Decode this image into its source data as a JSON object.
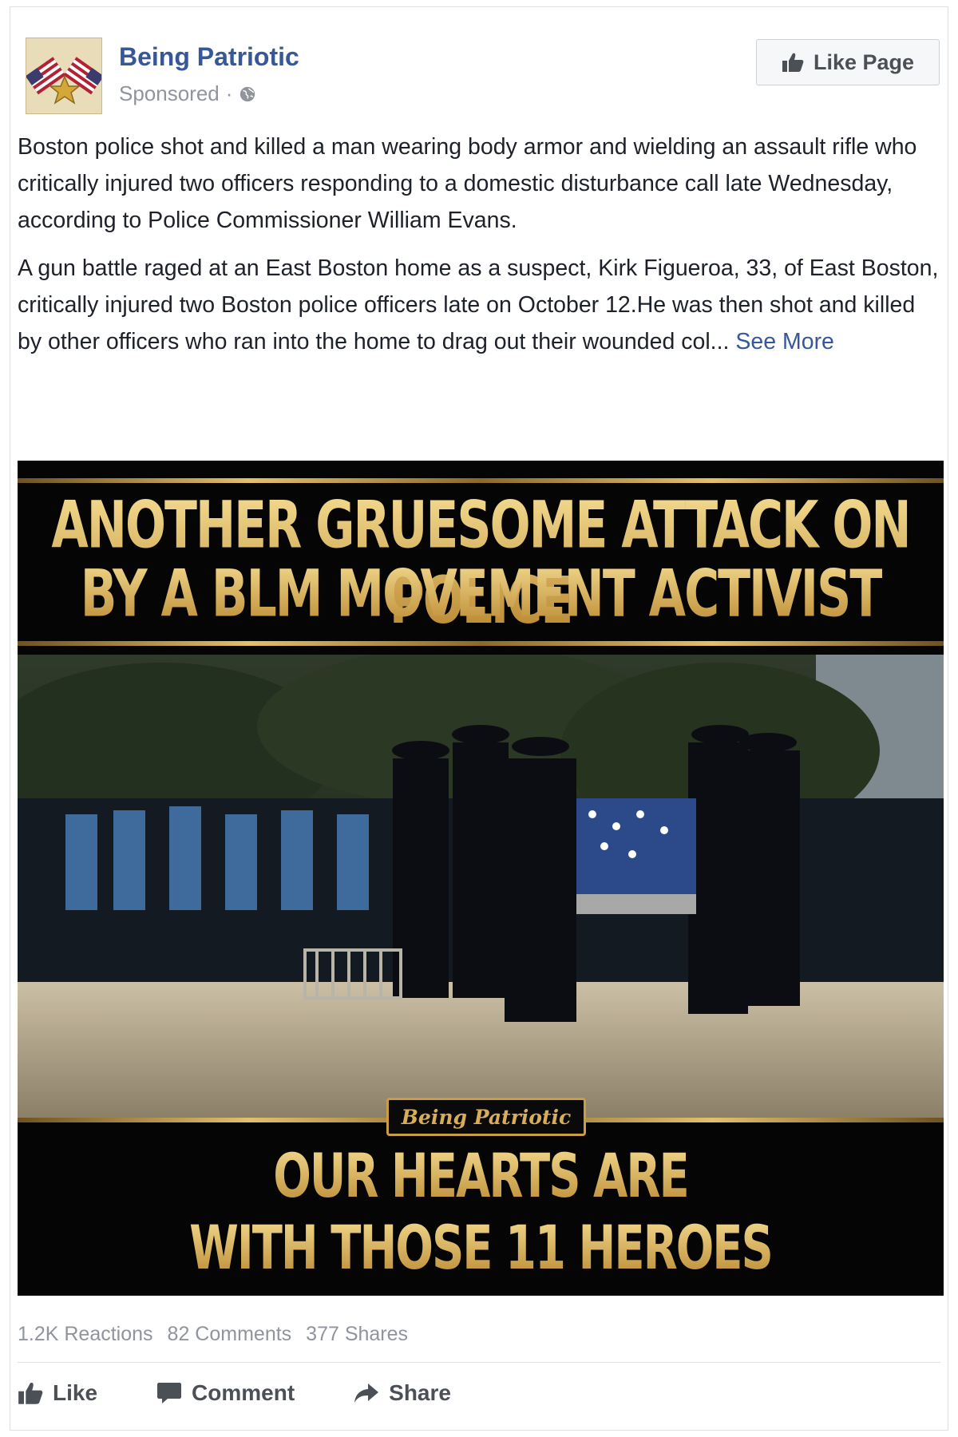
{
  "post": {
    "page_name": "Being Patriotic",
    "sponsored_label": "Sponsored",
    "meta_separator": "·",
    "like_page_label": "Like Page",
    "paragraphs": [
      "Boston police shot and killed a man wearing body armor and wielding an assault rifle who critically injured two officers responding to a domestic disturbance call late Wednesday, according to Police Commissioner William Evans.",
      "A gun battle raged at an East Boston home as a suspect, Kirk Figueroa, 33, of East Boston, critically injured two Boston police officers late on October 12.He was then shot and killed by other officers who ran into the home to drag out their wounded col..."
    ],
    "see_more_label": "See More"
  },
  "image": {
    "headline_line1": "ANOTHER GRUESOME ATTACK ON POLICE",
    "headline_line2": "BY A BLM MOVEMENT ACTIVIST",
    "watermark": "Being Patriotic",
    "footer_line1": "OUR HEARTS ARE",
    "footer_line2": "WITH THOSE 11 HEROES"
  },
  "stats": {
    "reactions": "1.2K Reactions",
    "comments": "82 Comments",
    "shares": "377 Shares"
  },
  "actions": {
    "like": "Like",
    "comment": "Comment",
    "share": "Share"
  },
  "colors": {
    "link_blue": "#365899",
    "meta_gray": "#90949c",
    "gold": "#d9b25a",
    "button_text": "#4b4f56"
  },
  "icons": [
    "flags-avatar-icon",
    "globe-icon",
    "thumbs-up-icon",
    "comment-icon",
    "share-arrow-icon"
  ]
}
